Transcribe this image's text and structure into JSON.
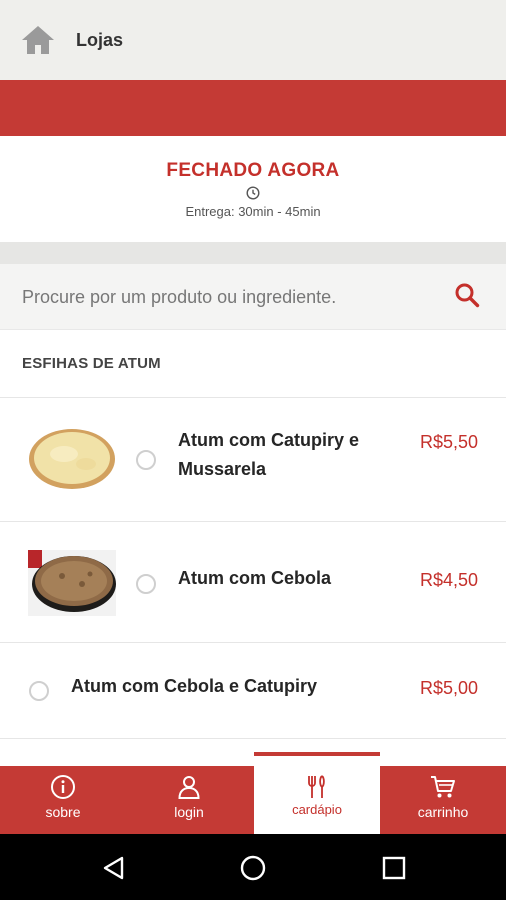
{
  "topbar": {
    "title": "Lojas",
    "icon": "home-icon"
  },
  "store": {
    "status": "FECHADO AGORA",
    "delivery": "Entrega: 30min - 45min"
  },
  "search": {
    "placeholder": "Procure por um produto ou ingrediente."
  },
  "section": {
    "title": "ESFIHAS DE ATUM"
  },
  "items": [
    {
      "name_line1": "Atum com Catupiry e",
      "name_line2": "Mussarela",
      "price": "R$5,50",
      "thumb": "cheese-pizza-image"
    },
    {
      "name": "Atum com Cebola",
      "price": "R$4,50",
      "thumb": "onion-tuna-pizza-image"
    },
    {
      "name": "Atum com Cebola e Catupiry",
      "price": "R$5,00"
    }
  ],
  "nav": {
    "tabs": [
      {
        "label": "sobre",
        "icon": "info-icon"
      },
      {
        "label": "login",
        "icon": "user-icon"
      },
      {
        "label": "cardápio",
        "icon": "cutlery-icon",
        "active": true
      },
      {
        "label": "carrinho",
        "icon": "cart-icon"
      }
    ]
  },
  "colors": {
    "brand": "#c43a35",
    "price": "#c4302b",
    "topbar": "#efefec"
  }
}
